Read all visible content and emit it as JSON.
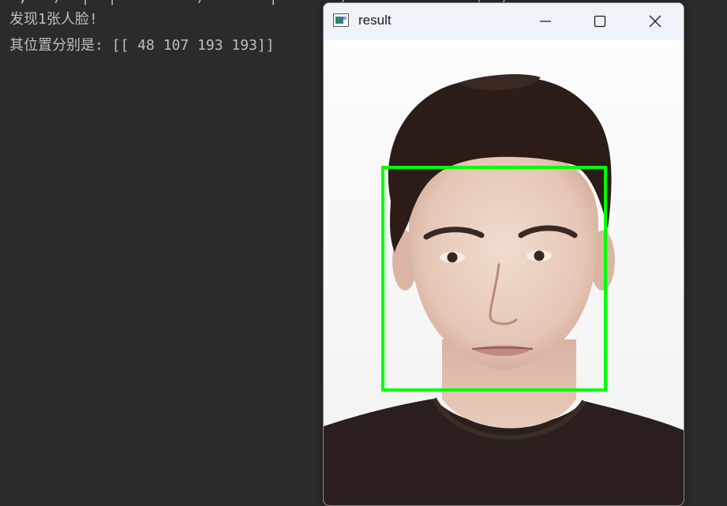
{
  "console": {
    "cut_line": "ʼ, ʼ /  |  |  ʼ  ʼ  ʼ/  ʼ  ʼ |  ʼ  ʼ /  ʼ  ʼ ʼ ʼ  ʼ |  /  ʼ",
    "line1": "发现1张人脸!",
    "line2": "其位置分别是: [[ 48 107 193 193]]"
  },
  "window": {
    "title": "result",
    "controls": {
      "minimize": "minimize-icon",
      "maximize": "maximize-icon",
      "close": "close-icon"
    }
  },
  "detection": {
    "box_color": "#00ff00"
  },
  "colors": {
    "console_bg": "#2b2b2b",
    "console_text": "#bcbec4",
    "titlebar_bg": "#eef3fa"
  }
}
